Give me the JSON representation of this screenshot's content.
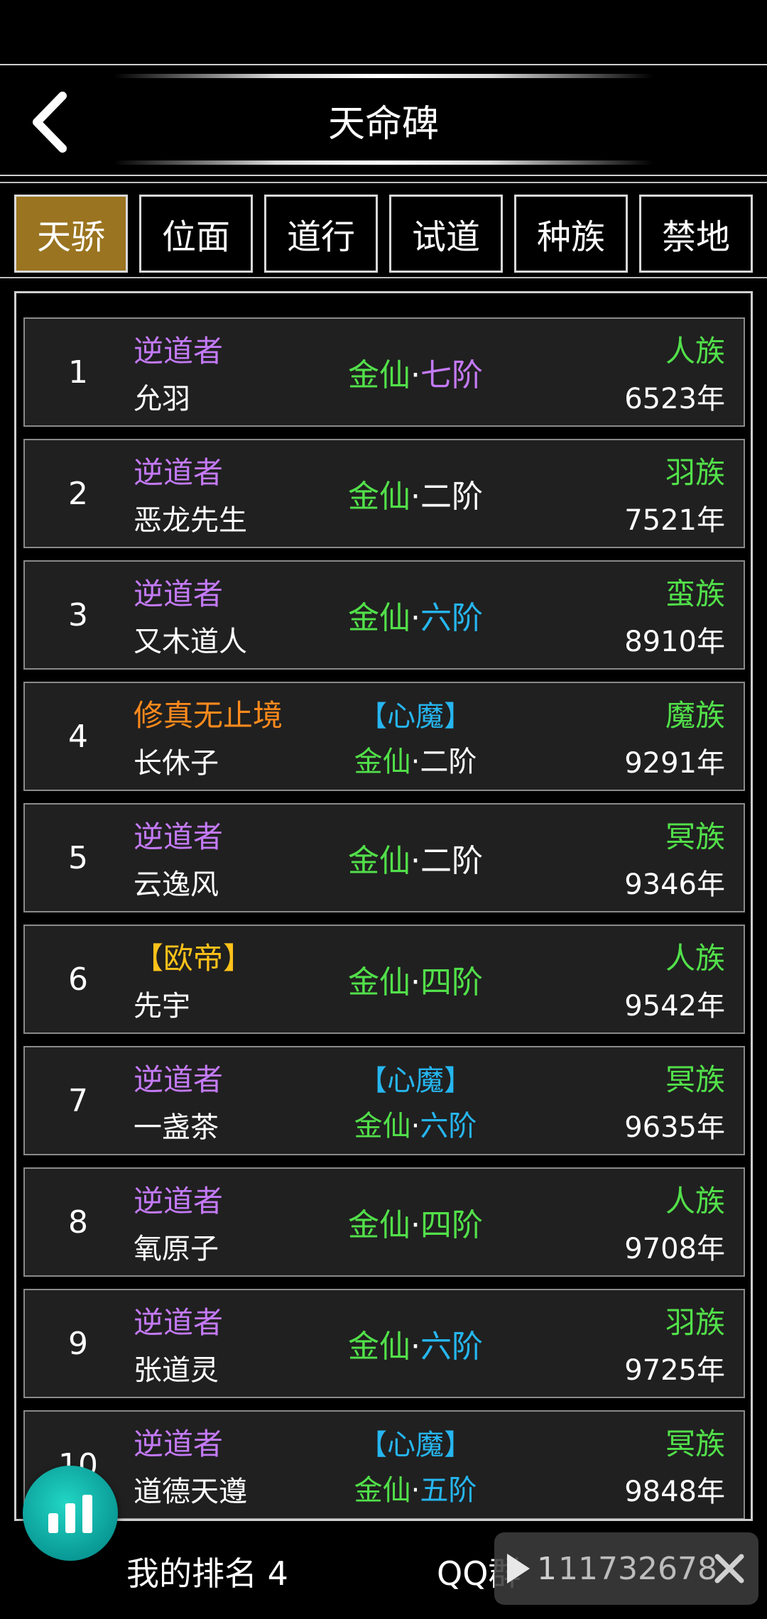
{
  "header": {
    "title": "天命碑"
  },
  "tabs": [
    {
      "label": "天骄",
      "active": true
    },
    {
      "label": "位面",
      "active": false
    },
    {
      "label": "道行",
      "active": false
    },
    {
      "label": "试道",
      "active": false
    },
    {
      "label": "种族",
      "active": false
    },
    {
      "label": "禁地",
      "active": false
    }
  ],
  "rows": [
    {
      "rank": "1",
      "title": "逆道者",
      "name": "允羽",
      "heart": "",
      "realm": "金仙",
      "stage": "七阶",
      "race": "人族",
      "age": "6523年"
    },
    {
      "rank": "2",
      "title": "逆道者",
      "name": "恶龙先生",
      "heart": "",
      "realm": "金仙",
      "stage": "二阶",
      "race": "羽族",
      "age": "7521年"
    },
    {
      "rank": "3",
      "title": "逆道者",
      "name": "又木道人",
      "heart": "",
      "realm": "金仙",
      "stage": "六阶",
      "race": "蛮族",
      "age": "8910年"
    },
    {
      "rank": "4",
      "title": "修真无止境",
      "name": "长休子",
      "heart": "【心魔】",
      "realm": "金仙",
      "stage": "二阶",
      "race": "魔族",
      "age": "9291年"
    },
    {
      "rank": "5",
      "title": "逆道者",
      "name": "云逸风",
      "heart": "",
      "realm": "金仙",
      "stage": "二阶",
      "race": "冥族",
      "age": "9346年"
    },
    {
      "rank": "6",
      "title": "【欧帝】",
      "name": "先宇",
      "heart": "",
      "realm": "金仙",
      "stage": "四阶",
      "race": "人族",
      "age": "9542年"
    },
    {
      "rank": "7",
      "title": "逆道者",
      "name": "一盏茶",
      "heart": "【心魔】",
      "realm": "金仙",
      "stage": "六阶",
      "race": "冥族",
      "age": "9635年"
    },
    {
      "rank": "8",
      "title": "逆道者",
      "name": "氧原子",
      "heart": "",
      "realm": "金仙",
      "stage": "四阶",
      "race": "人族",
      "age": "9708年"
    },
    {
      "rank": "9",
      "title": "逆道者",
      "name": "张道灵",
      "heart": "",
      "realm": "金仙",
      "stage": "六阶",
      "race": "羽族",
      "age": "9725年"
    },
    {
      "rank": "10",
      "title": "逆道者",
      "name": "道德天遵",
      "heart": "【心魔】",
      "realm": "金仙",
      "stage": "五阶",
      "race": "冥族",
      "age": "9848年"
    }
  ],
  "footer": {
    "my_rank": "我的排名 4",
    "qq_group": "QQ群",
    "qq_overlay_text": "1",
    "qq_number": "11732678"
  },
  "colors": {
    "title_default": "#c47af7",
    "title_orange": "#ff8a1c",
    "title_yellow": "#ffc21a",
    "realm_green": "#52e04a",
    "stage_purple": "#c47af7",
    "stage_white": "#ffffff",
    "stage_blue": "#26b6f0",
    "active_tab": "#9a7420",
    "fab": "#12b8ae"
  },
  "row_styles": [
    {
      "title_color": "purple",
      "stage_color": "purple"
    },
    {
      "title_color": "purple",
      "stage_color": "white"
    },
    {
      "title_color": "purple",
      "stage_color": "blue"
    },
    {
      "title_color": "orange",
      "stage_color": "white"
    },
    {
      "title_color": "purple",
      "stage_color": "white"
    },
    {
      "title_color": "yellow",
      "stage_color": "green"
    },
    {
      "title_color": "purple",
      "stage_color": "blue"
    },
    {
      "title_color": "purple",
      "stage_color": "green"
    },
    {
      "title_color": "purple",
      "stage_color": "blue"
    },
    {
      "title_color": "purple",
      "stage_color": "blue"
    }
  ],
  "icons": {
    "back": "chevron-left-icon",
    "fab": "bar-chart-icon",
    "play": "play-icon",
    "close": "close-icon"
  }
}
